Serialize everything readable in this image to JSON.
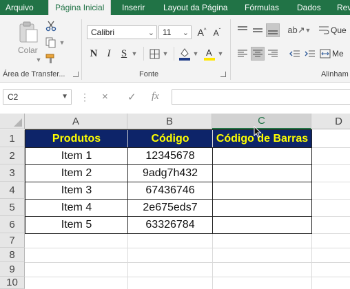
{
  "ribbon": {
    "tabs": [
      "Arquivo",
      "Página Inicial",
      "Inserir",
      "Layout da Página",
      "Fórmulas",
      "Dados",
      "Rev"
    ],
    "active_tab": "Página Inicial",
    "clipboard": {
      "paste_label": "Colar",
      "group_label": "Área de Transfer..."
    },
    "font": {
      "name": "Calibri",
      "size": "11",
      "group_label": "Fonte",
      "bold": "N",
      "italic": "I",
      "underline": "S"
    },
    "alignment": {
      "group_label": "Alinham",
      "wrap_label": "Que",
      "merge_label": "Me"
    }
  },
  "formula_bar": {
    "name_box": "C2",
    "cancel": "×",
    "enter": "✓",
    "fx": "fx",
    "content": ""
  },
  "grid": {
    "columns": [
      "A",
      "B",
      "C",
      "D"
    ],
    "selected_column": "C",
    "rows": [
      "1",
      "2",
      "3",
      "4",
      "5",
      "6",
      "7",
      "8",
      "9",
      "10"
    ],
    "table": {
      "headers": [
        "Produtos",
        "Código",
        "Código de Barras"
      ],
      "rows": [
        [
          "Item 1",
          "12345678",
          ""
        ],
        [
          "Item 2",
          "9adg7h432",
          ""
        ],
        [
          "Item 3",
          "67436746",
          ""
        ],
        [
          "Item 4",
          "2e675eds7",
          ""
        ],
        [
          "Item 5",
          "63326784",
          ""
        ]
      ]
    }
  },
  "colors": {
    "ribbon_green": "#217346",
    "header_fill": "#0d2469",
    "header_text": "#ffff00"
  }
}
